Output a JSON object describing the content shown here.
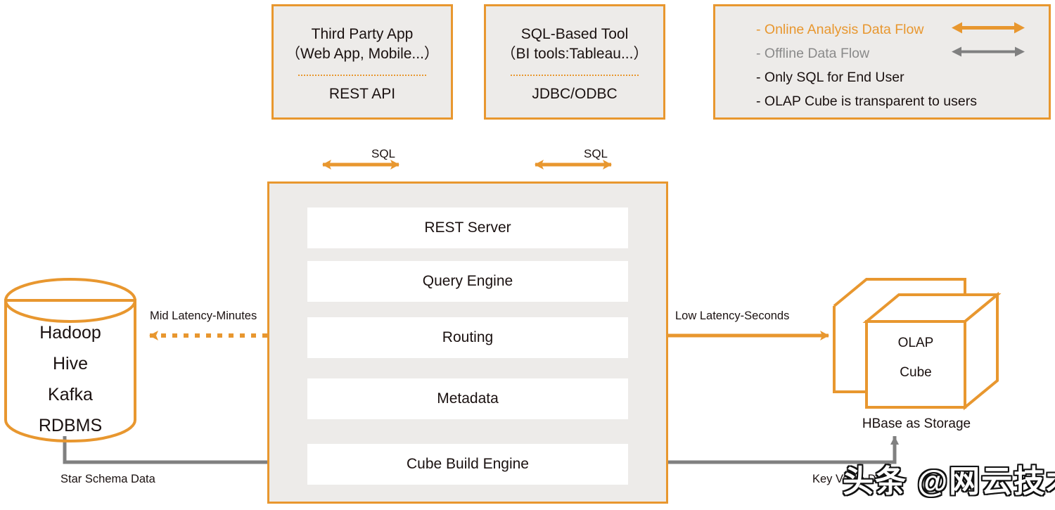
{
  "colors": {
    "accent_orange": "#E8972F",
    "panel_fill": "#EDEBE9",
    "layer_fill": "#FFFFFF",
    "offline_gray": "#808080",
    "text_dark": "#1a1110"
  },
  "clients": [
    {
      "id": "third-party-app",
      "title": "Third Party App\n（Web App, Mobile...）",
      "api": "REST API"
    },
    {
      "id": "sql-based-tool",
      "title": "SQL-Based Tool\n（BI tools:Tableau...）",
      "api": "JDBC/ODBC"
    }
  ],
  "legend": {
    "items": [
      {
        "label": "- Online Analysis Data Flow",
        "style": "online",
        "arrow": "double-arrow-orange",
        "has_arrow": true
      },
      {
        "label": "- Offline Data Flow",
        "style": "offline",
        "arrow": "double-arrow-gray",
        "has_arrow": true
      },
      {
        "label": "- Only SQL for End User",
        "style": "plain",
        "arrow": "",
        "has_arrow": false
      },
      {
        "label": "- OLAP Cube is transparent to users",
        "style": "plain",
        "arrow": "",
        "has_arrow": false
      }
    ]
  },
  "engine": {
    "layers": [
      {
        "id": "rest-server",
        "label": "REST Server"
      },
      {
        "id": "query-engine",
        "label": "Query Engine"
      },
      {
        "id": "routing",
        "label": "Routing"
      },
      {
        "id": "metadata",
        "label": "Metadata"
      },
      {
        "id": "cube-build-engine",
        "label": "Cube Build Engine"
      }
    ]
  },
  "source_store": {
    "id": "hadoop-cylinder",
    "lines": [
      "Hadoop",
      "Hive",
      "Kafka",
      "RDBMS"
    ]
  },
  "cube_store": {
    "id": "olap-cube",
    "lines": [
      "OLAP",
      "Cube"
    ],
    "caption": "HBase  as Storage"
  },
  "connector_labels": {
    "sql_left": "SQL",
    "sql_right": "SQL",
    "mid_latency": "Mid Latency-Minutes",
    "low_latency": "Low Latency-Seconds",
    "star_schema": "Star Schema Data",
    "key_value": "Key Value Data"
  },
  "watermark": {
    "text": "头条 @网云技术"
  }
}
